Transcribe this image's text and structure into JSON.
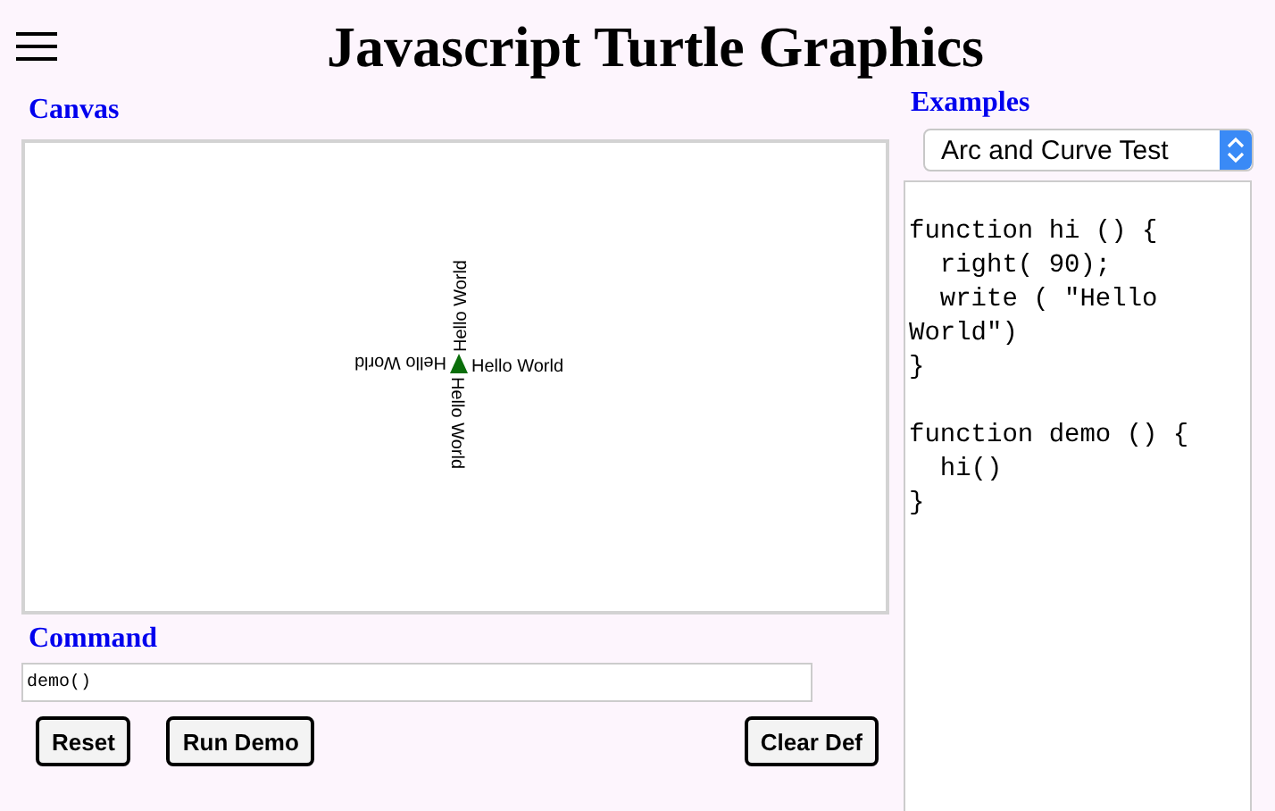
{
  "header": {
    "title": "Javascript Turtle Graphics"
  },
  "canvas": {
    "label": "Canvas",
    "writings": [
      {
        "text": "Hello World"
      },
      {
        "text": "Hello World"
      },
      {
        "text": "Hello World"
      },
      {
        "text": "Hello World"
      }
    ]
  },
  "command": {
    "label": "Command",
    "value": "demo()"
  },
  "buttons": [
    {
      "label": "Reset"
    },
    {
      "label": "Run Demo"
    },
    {
      "label": "Clear Def"
    }
  ],
  "examples": {
    "label": "Examples",
    "selected": "Arc and Curve Test"
  },
  "editor": {
    "code": "\nfunction hi () {\n  right( 90);\n  write ( \"Hello World\")\n}\n\nfunction demo () {\n  hi()\n}"
  }
}
